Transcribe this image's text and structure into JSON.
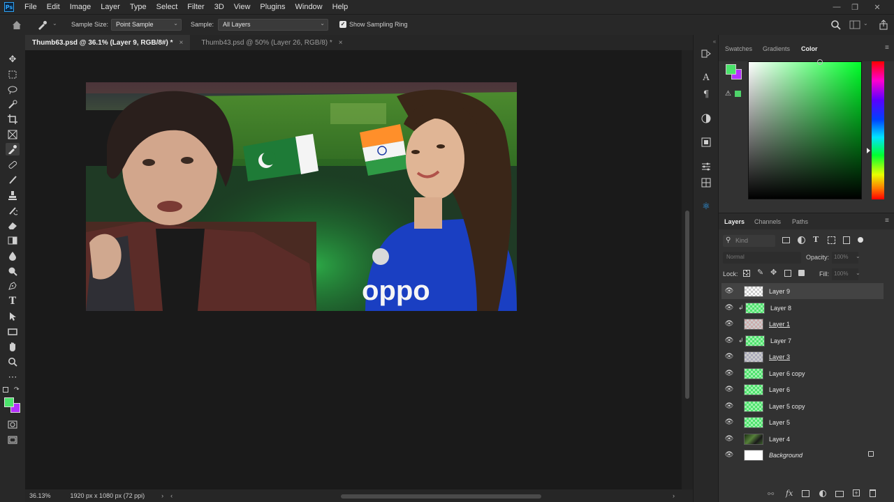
{
  "app": {
    "logo": "Ps"
  },
  "menu": [
    "File",
    "Edit",
    "Image",
    "Layer",
    "Type",
    "Select",
    "Filter",
    "3D",
    "View",
    "Plugins",
    "Window",
    "Help"
  ],
  "window_controls": [
    "minimize-icon",
    "restore-icon",
    "close-icon"
  ],
  "options_bar": {
    "sample_size_label": "Sample Size:",
    "sample_size_value": "Point Sample",
    "sample_label": "Sample:",
    "sample_value": "All Layers",
    "show_sampling_ring_label": "Show Sampling Ring",
    "show_sampling_ring_checked": true
  },
  "tabs": [
    {
      "label": "Thumb63.psd @ 36.1% (Layer 9, RGB/8#) *",
      "active": true
    },
    {
      "label": "Thumb43.psd @ 50% (Layer 26, RGB/8) *",
      "active": false
    }
  ],
  "tools": [
    "move-tool-icon",
    "marquee-tool-icon",
    "lasso-tool-icon",
    "quick-selection-icon",
    "crop-tool-icon",
    "frame-tool-icon",
    "eyedropper-tool-icon",
    "healing-brush-icon",
    "brush-tool-icon",
    "clone-stamp-icon",
    "history-brush-icon",
    "eraser-tool-icon",
    "gradient-tool-icon",
    "blur-tool-icon",
    "dodge-tool-icon",
    "pen-tool-icon",
    "type-tool-icon",
    "path-selection-icon",
    "rectangle-tool-icon",
    "hand-tool-icon",
    "zoom-tool-icon",
    "more-tools-icon"
  ],
  "status": {
    "zoom": "36.13%",
    "doc_info": "1920 px x 1080 px (72 ppi)"
  },
  "color_panel": {
    "tabs": [
      "Swatches",
      "Gradients",
      "Color"
    ],
    "active_tab": "Color",
    "foreground": "#4be36b",
    "background": "#b530ff"
  },
  "layers_panel": {
    "tabs": [
      "Layers",
      "Channels",
      "Paths"
    ],
    "active_tab": "Layers",
    "filter_placeholder": "Kind",
    "blend_mode": "Normal",
    "opacity_label": "Opacity:",
    "opacity_value": "100%",
    "lock_label": "Lock:",
    "fill_label": "Fill:",
    "fill_value": "100%",
    "layers": [
      {
        "name": "Layer 9",
        "selected": true,
        "clipped": false,
        "thumb": "checker"
      },
      {
        "name": "Layer 8",
        "selected": false,
        "clipped": true,
        "thumb": "greenchk"
      },
      {
        "name": "Layer 1",
        "selected": false,
        "clipped": false,
        "thumb": "checker"
      },
      {
        "name": "Layer 7",
        "selected": false,
        "clipped": true,
        "thumb": "greenchk"
      },
      {
        "name": "Layer 3",
        "selected": false,
        "clipped": false,
        "thumb": "checker"
      },
      {
        "name": "Layer 6 copy",
        "selected": false,
        "clipped": false,
        "thumb": "greenchk"
      },
      {
        "name": "Layer 6",
        "selected": false,
        "clipped": false,
        "thumb": "greenchk"
      },
      {
        "name": "Layer 5 copy",
        "selected": false,
        "clipped": false,
        "thumb": "greenchk"
      },
      {
        "name": "Layer 5",
        "selected": false,
        "clipped": false,
        "thumb": "greenchk"
      },
      {
        "name": "Layer 4",
        "selected": false,
        "clipped": false,
        "thumb": "photo"
      },
      {
        "name": "Background",
        "selected": false,
        "clipped": false,
        "thumb": "white"
      }
    ]
  },
  "canvas_image": {
    "jersey_text": "oppo"
  }
}
